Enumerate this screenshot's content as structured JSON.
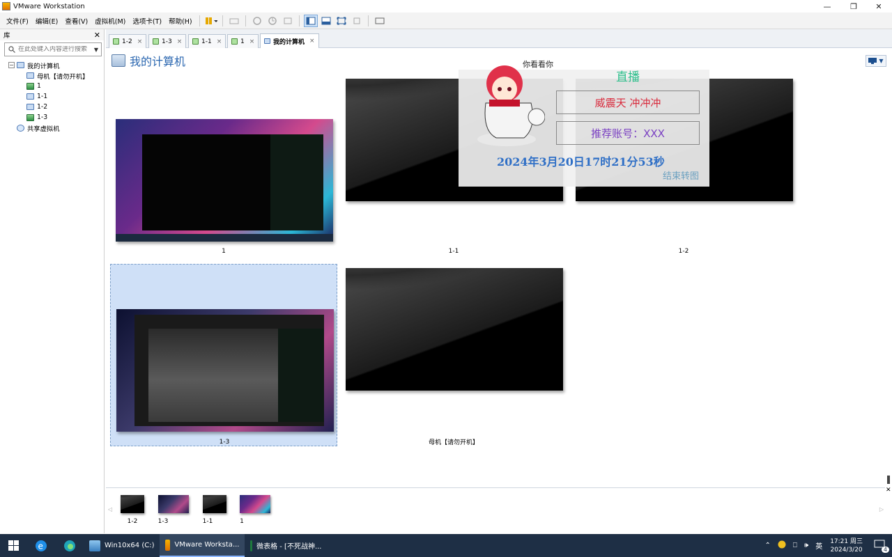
{
  "window": {
    "title": "VMware Workstation"
  },
  "menu": [
    "文件(F)",
    "编辑(E)",
    "查看(V)",
    "虚拟机(M)",
    "选项卡(T)",
    "帮助(H)"
  ],
  "library": {
    "title": "库",
    "search_placeholder": "在此处键入内容进行搜索",
    "tree": {
      "root": "我的计算机",
      "children": [
        "母机【请勿开机】",
        "1",
        "1-1",
        "1-2",
        "1-3"
      ],
      "shared": "共享虚拟机"
    }
  },
  "tabs": [
    {
      "label": "1-2",
      "close": "×"
    },
    {
      "label": "1-3",
      "close": "×"
    },
    {
      "label": "1-1",
      "close": "×"
    },
    {
      "label": "1",
      "close": "×"
    },
    {
      "label": "我的计算机",
      "close": "×",
      "active": true
    }
  ],
  "page": {
    "title": "我的计算机",
    "view_button": "▼"
  },
  "vms": [
    {
      "name": "1",
      "state": "desktop"
    },
    {
      "name": "1-1",
      "state": "black"
    },
    {
      "name": "1-2",
      "state": "black"
    },
    {
      "name": "1-3",
      "state": "game",
      "selected": true
    },
    {
      "name": "母机【请勿开机】",
      "state": "black"
    }
  ],
  "overlay": {
    "kanban": "你看看你",
    "live_label": "直播",
    "box1": "威震天  冲冲冲",
    "box2": "推荐账号：XXX",
    "datetime": "2024年3月20日17时21分53秒",
    "end_label": "结束转图",
    "colors": {
      "box1": "#d8283a",
      "box2": "#7a3fc2",
      "live": "#2dbf8c"
    }
  },
  "filmstrip": [
    {
      "name": "1-2",
      "state": "black"
    },
    {
      "name": "1-3",
      "state": "game"
    },
    {
      "name": "1-1",
      "state": "black"
    },
    {
      "name": "1",
      "state": "desktop"
    }
  ],
  "taskbar": {
    "items": [
      {
        "label": "Win10x64 (C:)"
      },
      {
        "label": "VMware Worksta...",
        "active": true
      },
      {
        "label": "微表格 - [不死战神..."
      }
    ],
    "tray": {
      "ime": "英",
      "time": "17:21 周三",
      "date": "2024/3/20",
      "notifications": "4"
    }
  }
}
